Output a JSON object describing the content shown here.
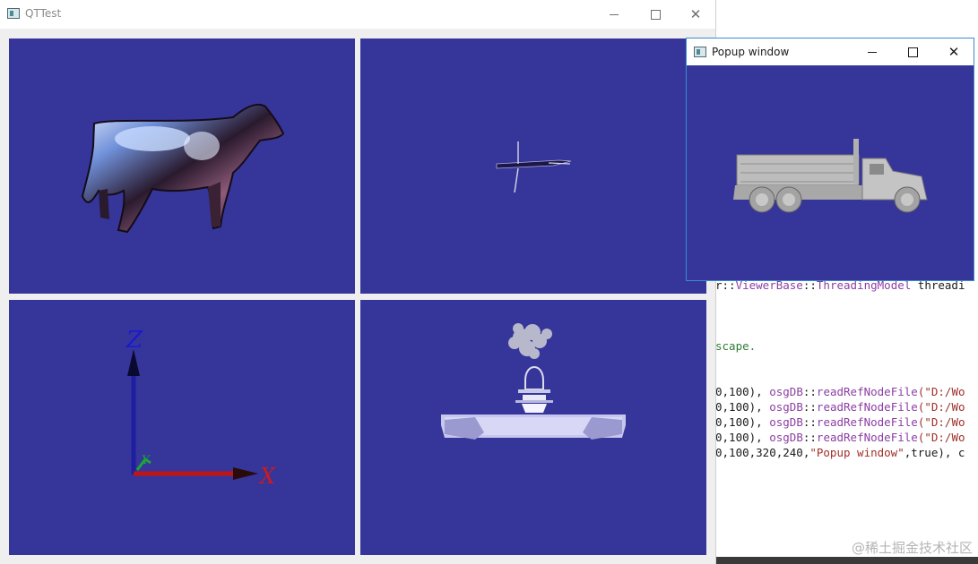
{
  "main_window": {
    "title": "QTTest",
    "close_glyph": "✕"
  },
  "popup_window": {
    "title": "Popup window",
    "close_glyph": "✕"
  },
  "editor": {
    "line1": {
      "a": "r::",
      "b": "ViewerBase",
      "c": "::",
      "d": "ThreadingModel",
      "e": " threadi"
    },
    "line2": "scape.",
    "line3": {
      "a": "0,100), ",
      "b": "osgDB",
      "c": "::",
      "d": "readRefNodeFile",
      "e": "(\"D:/Wo"
    },
    "line4": {
      "a": "0,100), ",
      "b": "osgDB",
      "c": "::",
      "d": "readRefNodeFile",
      "e": "(\"D:/Wo"
    },
    "line5": {
      "a": "0,100), ",
      "b": "osgDB",
      "c": "::",
      "d": "readRefNodeFile",
      "e": "(\"D:/Wo"
    },
    "line6": {
      "a": "0,100), ",
      "b": "osgDB",
      "c": "::",
      "d": "readRefNodeFile",
      "e": "(\"D:/Wo"
    },
    "line7": {
      "a": "0,100,320,240,",
      "b": "\"Popup window\"",
      "c": ",true), c"
    }
  },
  "axes": {
    "z": "Z",
    "x": "X",
    "y": "Y"
  },
  "watermark": "@稀土掘金技术社区",
  "colors": {
    "viewport_bg": "#36359a",
    "accent": "#3b8bd0"
  }
}
